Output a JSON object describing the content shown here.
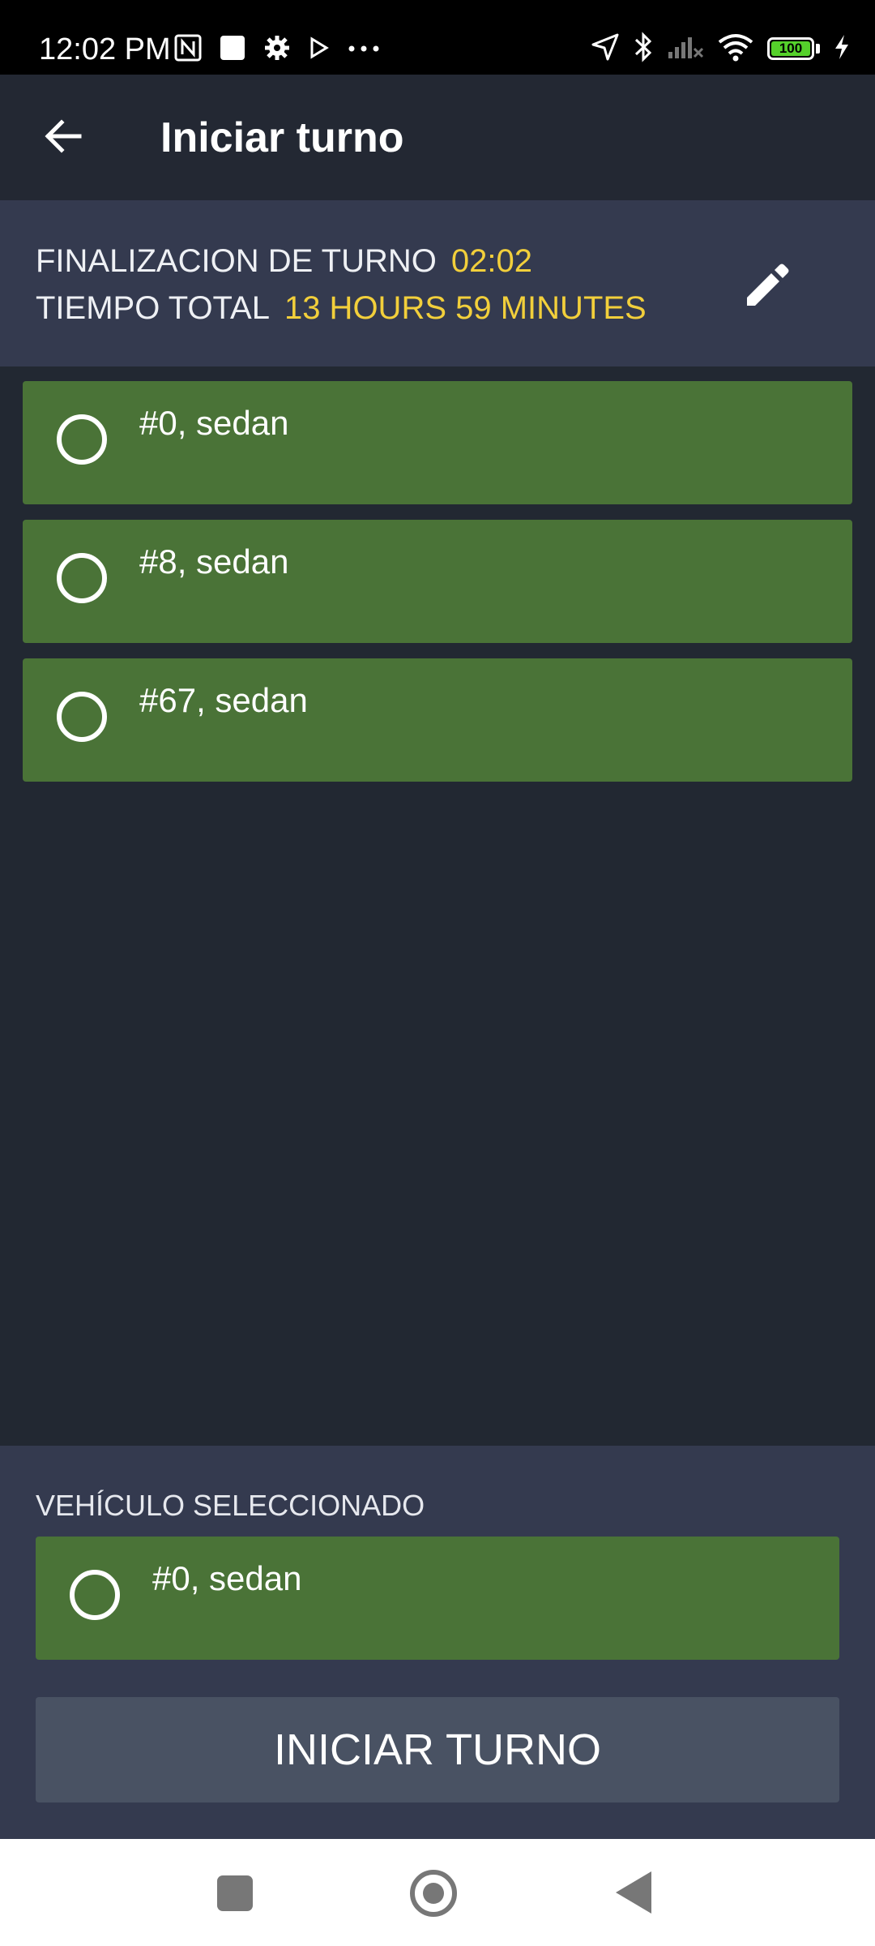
{
  "status_bar": {
    "time": "12:02 PM",
    "battery": "100",
    "icons": [
      "nfc-icon",
      "square-icon",
      "gear-icon",
      "play-icon",
      "more-dots-icon",
      "location-icon",
      "bluetooth-icon",
      "signal-icon",
      "wifi-icon",
      "battery-icon",
      "charging-icon"
    ]
  },
  "app_bar": {
    "title": "Iniciar turno"
  },
  "shift": {
    "end_label": "FINALIZACION DE TURNO",
    "end_value": "02:02",
    "total_label": "TIEMPO TOTAL",
    "total_value": "13 HOURS 59 MINUTES"
  },
  "vehicles": [
    {
      "label": "#0, sedan"
    },
    {
      "label": "#8, sedan"
    },
    {
      "label": "#67, sedan"
    }
  ],
  "selected": {
    "title": "VEHÍCULO SELECCIONADO",
    "vehicle": "#0, sedan"
  },
  "start_button": {
    "label": "INICIAR TURNO"
  },
  "colors": {
    "accent_yellow": "#f2cf3b",
    "card_green": "#4a7337",
    "background": "#222832",
    "panel": "#343a4f",
    "button": "#495263"
  }
}
